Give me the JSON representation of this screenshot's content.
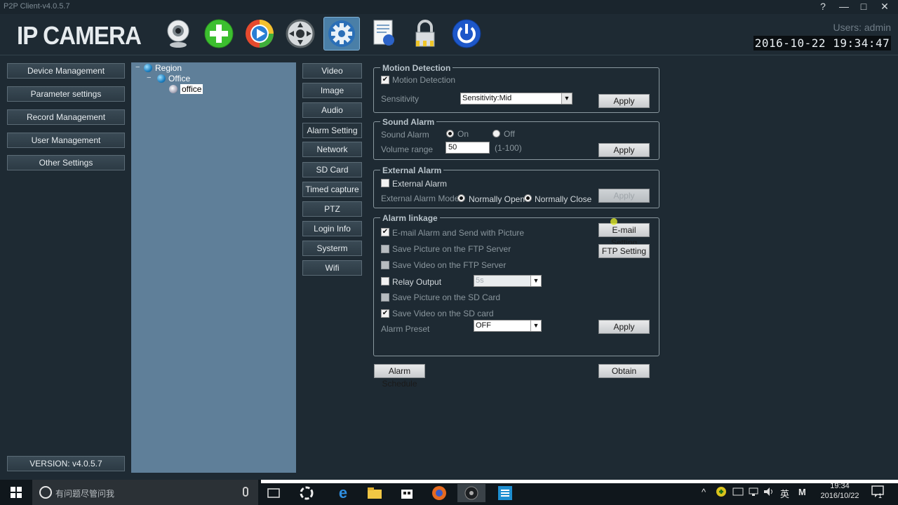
{
  "window": {
    "title": "P2P Client-v4.0.5.7",
    "help": "?",
    "minimize": "—",
    "maximize": "□",
    "close": "✕"
  },
  "header": {
    "logo": "IP CAMERA",
    "users": "Users: admin",
    "clock": "2016-10-22 19:34:47"
  },
  "toolbar": [
    "webcam-icon",
    "add-icon",
    "playback-icon",
    "ptz-icon",
    "settings-icon",
    "log-icon",
    "lock-icon",
    "power-icon"
  ],
  "nav": {
    "items": [
      "Device Management",
      "Parameter settings",
      "Record Management",
      "User Management",
      "Other Settings"
    ],
    "version": "VERSION: v4.0.5.7"
  },
  "tree": {
    "minus1": "−",
    "minus2": "−",
    "region": "Region",
    "office_group": "Office",
    "office_device": "office"
  },
  "subtabs": [
    "Video",
    "Image",
    "Audio",
    "Alarm Setting",
    "Network",
    "SD Card",
    "Timed capture",
    "PTZ",
    "Login Info",
    "Systerm",
    "Wifi"
  ],
  "motion": {
    "legend": "Motion Detection",
    "checkbox_label": "Motion Detection",
    "checked": true,
    "sensitivity_label": "Sensitivity",
    "sensitivity_value": "Sensitivity:Mid",
    "apply": "Apply"
  },
  "sound": {
    "legend": "Sound Alarm",
    "label": "Sound Alarm",
    "on": "On",
    "off": "Off",
    "volume_label": "Volume range",
    "volume_value": "50",
    "range_hint": "(1-100)",
    "apply": "Apply"
  },
  "external": {
    "legend": "External Alarm",
    "checkbox_label": "External Alarm",
    "mode_label": "External Alarm Mode",
    "normally_open": "Normally Open",
    "normally_close": "Normally Close",
    "apply": "Apply"
  },
  "linkage": {
    "legend": "Alarm linkage",
    "email": "E-mail Alarm and Send with Picture",
    "ftp_pic": "Save Picture on the FTP Server",
    "ftp_video": "Save Video on the FTP Server",
    "relay": "Relay Output",
    "relay_value": "5s",
    "sd_pic": "Save Picture on the SD Card",
    "sd_video": "Save Video on the SD card",
    "preset_label": "Alarm Preset",
    "preset_value": "OFF",
    "email_setting": "E-mail Setting",
    "ftp_setting": "FTP Setting",
    "apply": "Apply"
  },
  "footer_buttons": {
    "schedule": "Alarm Schedule",
    "obtain": "Obtain"
  },
  "taskbar": {
    "search_placeholder": "有问题尽管问我",
    "tray_lang": "英",
    "tray_ime": "M",
    "tray_time": "19:34",
    "tray_date": "2016/10/22",
    "notif_count": "1"
  }
}
